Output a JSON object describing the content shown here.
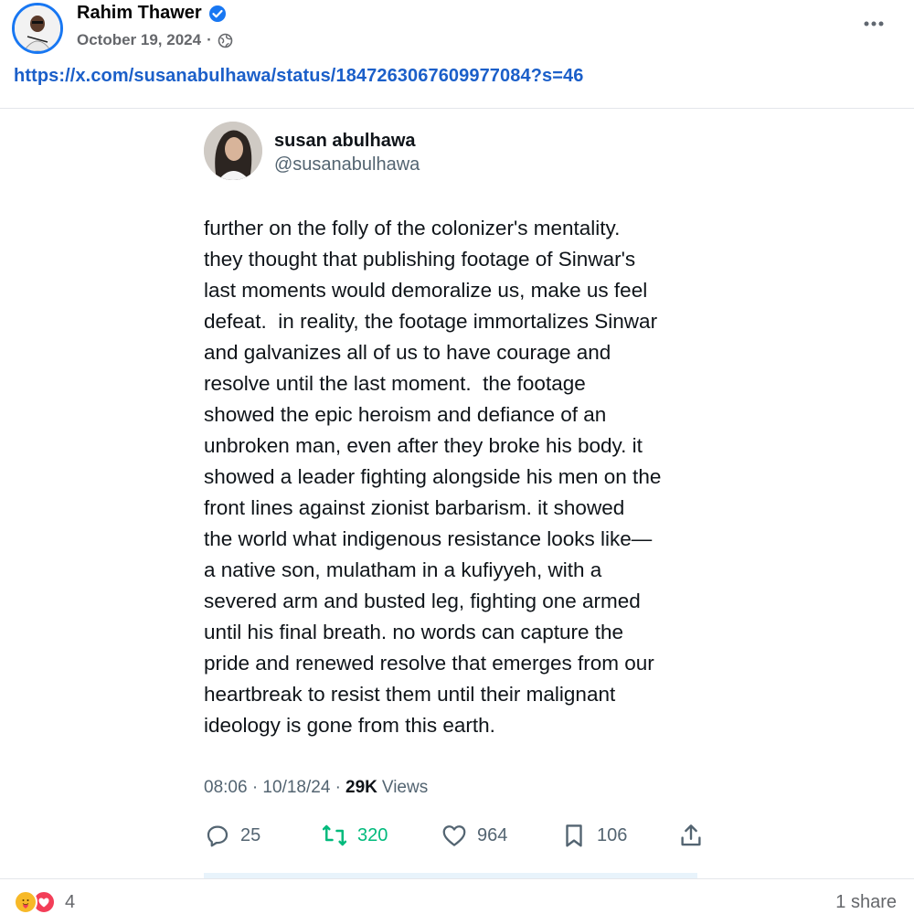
{
  "post": {
    "author": "Rahim Thawer",
    "date": "October 19, 2024",
    "separator": "·",
    "link": "https://x.com/susanabulhawa/status/1847263067609977084?s=46"
  },
  "tweet": {
    "name": "susan abulhawa",
    "handle": "@susanabulhawa",
    "text": "further on the folly of the colonizer's mentality.\nthey thought that publishing footage of Sinwar's\nlast moments would demoralize us, make us feel\ndefeat.  in reality, the footage immortalizes Sinwar\nand galvanizes all of us to have courage and\nresolve until the last moment.  the footage\nshowed the epic heroism and defiance of an\nunbroken man, even after they broke his body. it\nshowed a leader fighting alongside his men on the\nfront lines against zionist barbarism. it showed\nthe world what indigenous resistance looks like—\na native son, mulatham in a kufiyyeh, with a\nsevered arm and busted leg, fighting one armed\nuntil his final breath. no words can capture the\npride and renewed resolve that emerges from our\nheartbreak to resist them until their malignant\nideology is gone from this earth.",
    "time": "08:06 · 10/18/24 ·",
    "views_count": "29K",
    "views_label": "Views",
    "replies": "25",
    "retweets": "320",
    "likes": "964",
    "bookmarks": "106"
  },
  "footer": {
    "reaction_count": "4",
    "shares": "1 share"
  },
  "icons": {
    "verified": "verified-badge-icon",
    "audience": "globe-icon",
    "more": "more-options-icon",
    "reply": "reply-icon",
    "retweet": "retweet-icon",
    "like": "heart-icon",
    "bookmark": "bookmark-icon",
    "share": "share-icon",
    "reaction_care": "care-reaction-icon",
    "reaction_love": "love-reaction-icon"
  },
  "colors": {
    "facebook_blue": "#1877f2",
    "link_blue": "#1b5fc9",
    "retweet_green": "#00ba7c",
    "muted_gray": "#65676b",
    "tweet_gray": "#536471"
  }
}
